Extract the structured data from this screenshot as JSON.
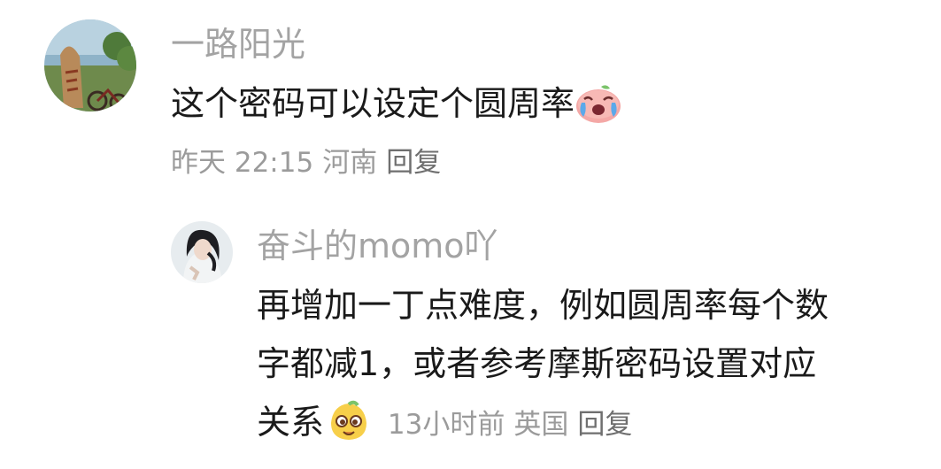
{
  "comment": {
    "username": "一路阳光",
    "text": "这个密码可以设定个圆周率",
    "emoji": "crying-face-emoji",
    "time": "昨天 22:15",
    "location": "河南",
    "reply_label": "回复"
  },
  "reply": {
    "username": "奋斗的momo吖",
    "text_line1": "再增加一丁点难度，例如圆周率每个数",
    "text_line2": "字都减1，或者参考摩斯密码设置对应",
    "text_line3": "关系",
    "emoji": "silly-face-emoji",
    "time": "13小时前",
    "location": "英国",
    "reply_label": "回复"
  }
}
